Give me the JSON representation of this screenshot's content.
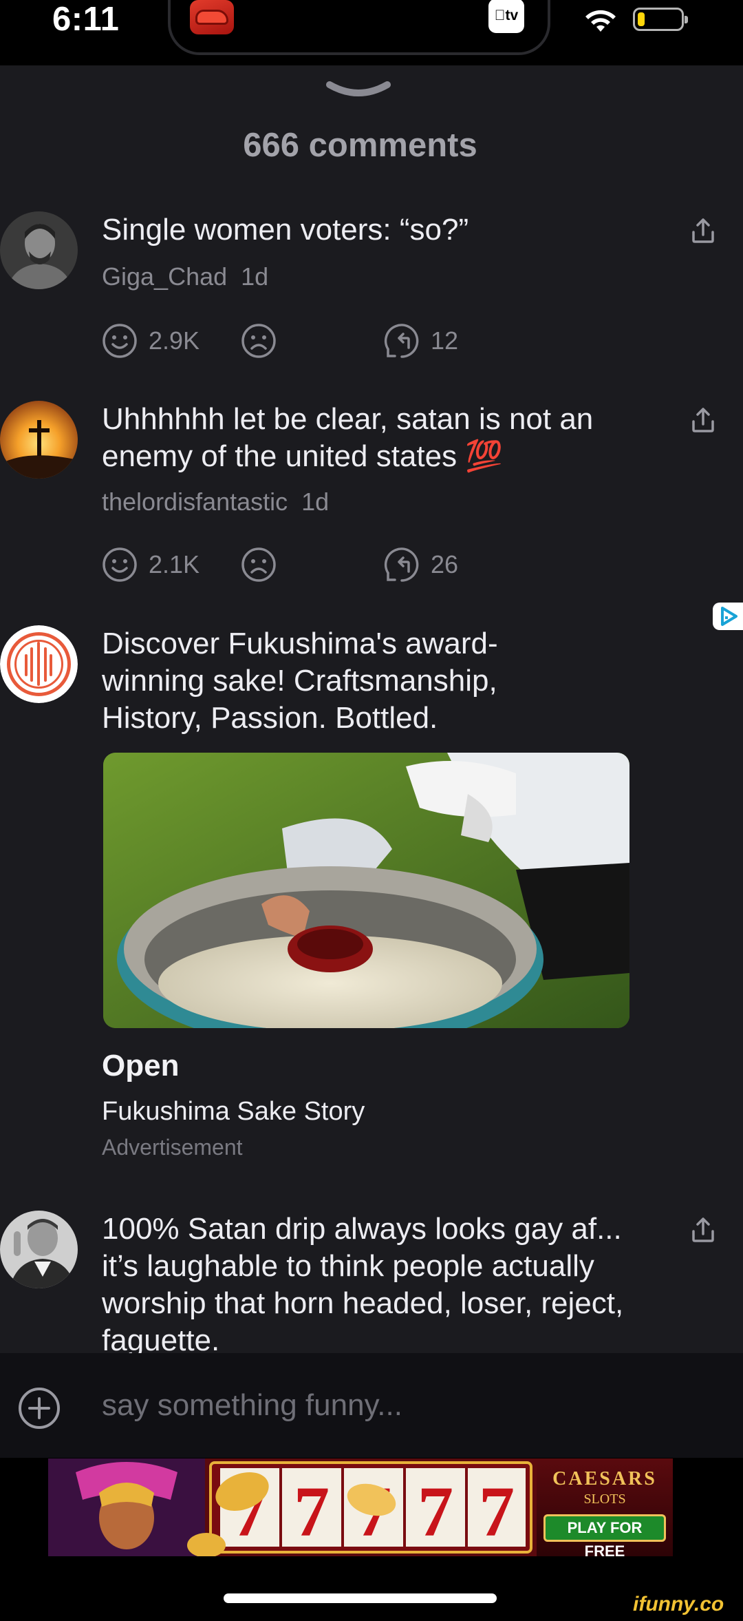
{
  "status_bar": {
    "time": "6:11",
    "tv_label": "tv",
    "icons": [
      "cars-app-icon",
      "apple-tv-icon",
      "wifi-icon",
      "battery-low-icon"
    ],
    "battery_level": 0.1,
    "battery_color": "#ffd60a"
  },
  "sheet": {
    "title": "666 comments"
  },
  "comments": [
    {
      "text": "Single women voters: “so?”",
      "username": "Giga_Chad",
      "time": "1d",
      "likes": "2.9K",
      "replies": "12"
    },
    {
      "text": "Uhhhhhh let be clear, satan is not an enemy of the united states 💯",
      "username": "thelordisfantastic",
      "time": "1d",
      "likes": "2.1K",
      "replies": "26"
    },
    {
      "text": "100% Satan drip always looks gay af... it’s laughable to think people actually worship that horn headed, loser, reject, faguette."
    }
  ],
  "ad": {
    "text": "Discover Fukushima's award-winning sake! Craftsmanship, History, Passion. Bottled.",
    "cta": "Open",
    "advertiser": "Fukushima Sake Story",
    "label": "Advertisement"
  },
  "composer": {
    "placeholder": "say something funny..."
  },
  "banner": {
    "brand": "CAESARS",
    "subtitle": "SLOTS",
    "cta": "PLAY FOR FREE"
  },
  "watermark": "ifunny.co",
  "colors": {
    "background": "#1b1b1f",
    "text": "#ededf2",
    "muted": "#8a8a92",
    "accent_ad": "#e85a3a"
  }
}
